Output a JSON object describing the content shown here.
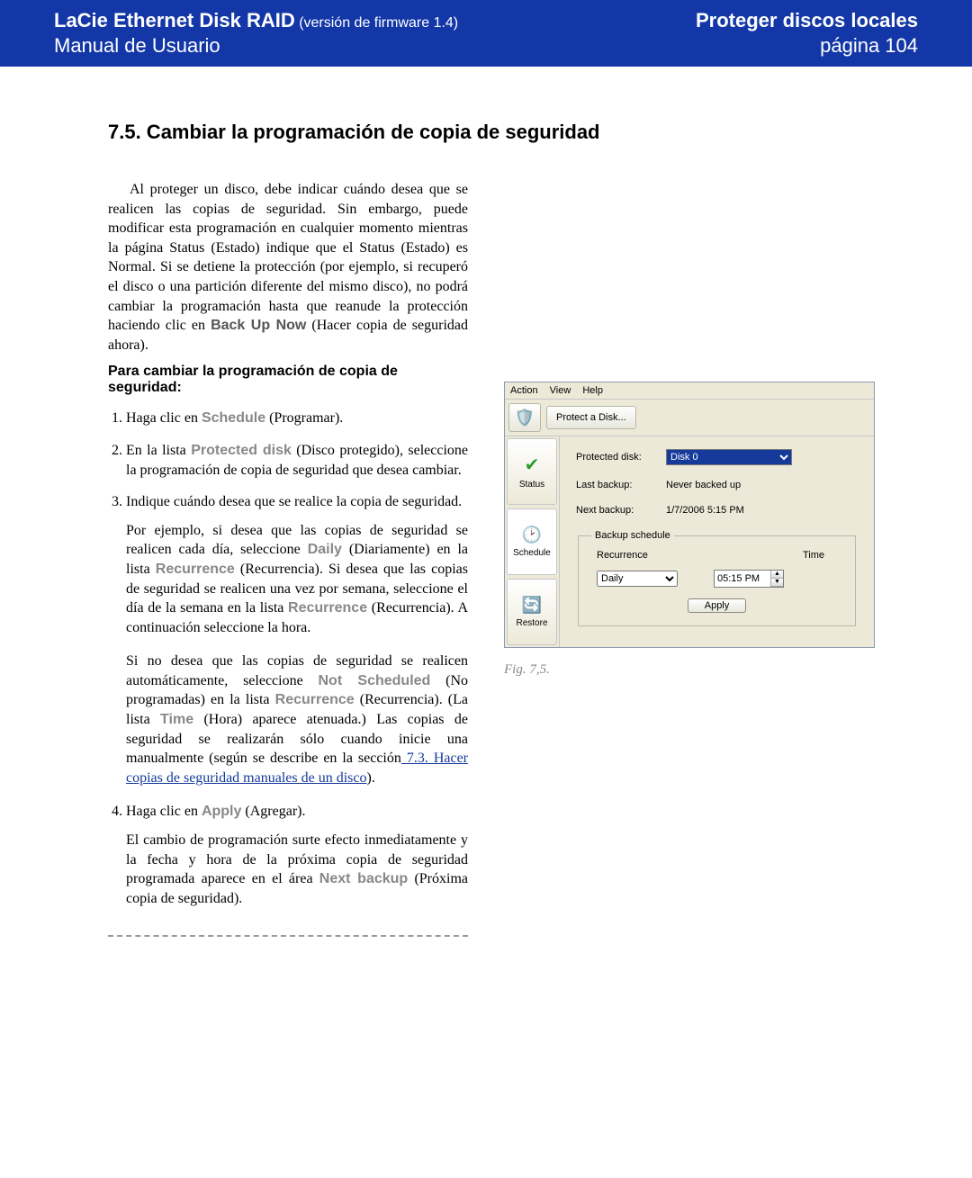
{
  "header": {
    "product": "LaCie Ethernet Disk RAID",
    "firmware": "(versión de firmware 1.4)",
    "subtitle": "Manual de Usuario",
    "chapter": "Proteger discos locales",
    "page": "página 104"
  },
  "section_title": "7.5. Cambiar la programación de copia de seguridad",
  "intro": {
    "part1": "Al proteger un disco, debe indicar cuándo desea que se realicen las copias de seguridad. Sin embargo, puede modificar esta programación en cualquier momento mientras la página Status (Estado) indique que el Status (Estado) es Normal. Si se detiene la protección (por ejemplo, si recuperó el disco o una partición diferente del mismo disco), no podrá cambiar la programación hasta que reanude la protección haciendo clic en ",
    "cmd": "Back Up Now",
    "part2": " (Hacer copia de seguridad ahora)."
  },
  "subhead": "Para cambiar la programación de copia de seguridad:",
  "steps": {
    "s1a": "Haga clic en ",
    "s1b": "Schedule",
    "s1c": " (Programar).",
    "s2a": "En la lista ",
    "s2b": "Protected disk",
    "s2c": " (Disco protegido), seleccione la programación de copia de seguridad que desea cambiar.",
    "s3": "Indique cuándo desea que se realice la copia de seguridad.",
    "s3p1a": "Por ejemplo, si desea que las copias de seguridad se realicen cada día, seleccione ",
    "s3p1b": "Daily",
    "s3p1c": " (Diariamente) en la lista ",
    "s3p1d": "Recurrence",
    "s3p1e": " (Recurrencia). Si desea que las copias de seguridad se realicen una vez por semana, seleccione el día de la semana en la lista ",
    "s3p1f": "Recurrence",
    "s3p1g": " (Recurrencia). A continuación seleccione la hora.",
    "s3p2a": "Si no desea que las copias de seguridad se realicen automáticamente, seleccione ",
    "s3p2b": "Not Scheduled",
    "s3p2c": " (No programadas) en la lista ",
    "s3p2d": "Recurrence",
    "s3p2e": " (Recurrencia). (La lista ",
    "s3p2f": "Time",
    "s3p2g": " (Hora) aparece atenuada.) Las copias de seguridad se realizarán sólo cuando inicie una manualmente (según se describe en la sección",
    "s3link": " 7.3. Hacer copias de seguridad manuales de un disco",
    "s3p2h": ").",
    "s4a": "Haga clic en ",
    "s4b": "Apply",
    "s4c": " (Agregar).",
    "s4p1a": "El cambio de programación surte efecto inmediatamente y la fecha y hora de la próxima copia de seguridad programada aparece en el área ",
    "s4p1b": "Next backup",
    "s4p1c": " (Próxima copia de seguridad)."
  },
  "figure": {
    "caption": "Fig. 7,5.",
    "menu": {
      "action": "Action",
      "view": "View",
      "help": "Help"
    },
    "toolbar": {
      "protect": "Protect a Disk..."
    },
    "tabs": {
      "status": "Status",
      "schedule": "Schedule",
      "restore": "Restore"
    },
    "panel": {
      "protected_disk_label": "Protected disk:",
      "protected_disk_value": "Disk 0",
      "last_backup_label": "Last backup:",
      "last_backup_value": "Never backed up",
      "next_backup_label": "Next backup:",
      "next_backup_value": "1/7/2006 5:15 PM",
      "legend": "Backup schedule",
      "recurrence_header": "Recurrence",
      "time_header": "Time",
      "recurrence_value": "Daily",
      "time_value": "05:15 PM",
      "apply": "Apply"
    }
  }
}
